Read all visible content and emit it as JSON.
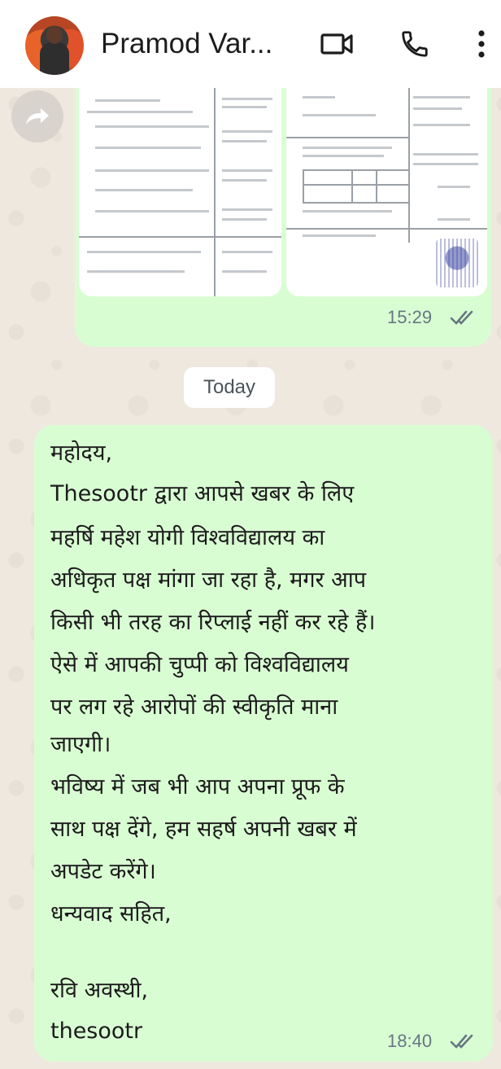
{
  "header": {
    "contact_name": "Pramod Var...",
    "avatar_icon": "avatar",
    "video_icon": "video-camera-icon",
    "call_icon": "phone-icon",
    "menu_icon": "more-vertical-icon"
  },
  "messages": [
    {
      "type": "image",
      "time": "15:29",
      "status": "read"
    },
    {
      "type": "text",
      "lines": [
        "महोदय,",
        "Thesootr द्वारा आपसे खबर के लिए",
        "महर्षि महेश योगी विश्वविद्यालय का",
        "अधिकृत पक्ष मांगा जा रहा है, मगर आप",
        "किसी भी तरह का रिप्लाई नहीं कर रहे हैं।",
        "ऐसे में आपकी चुप्पी को विश्वविद्यालय",
        "पर लग रहे आरोपों की स्वीकृति माना",
        "जाएगी।",
        "भविष्य में जब भी आप अपना प्रूफ के",
        "साथ पक्ष देंगे, हम सहर्ष अपनी खबर में",
        "अपडेट करेंगे।",
        "धन्यवाद सहित,",
        "",
        "रवि अवस्थी,",
        "thesootr"
      ],
      "time": "18:40",
      "status": "read"
    }
  ],
  "date_separator": "Today",
  "colors": {
    "outgoing_bubble": "#d9fdd3",
    "header_bg": "#ffffff",
    "wallpaper": "#efe8df",
    "read_tick": "#667781"
  }
}
